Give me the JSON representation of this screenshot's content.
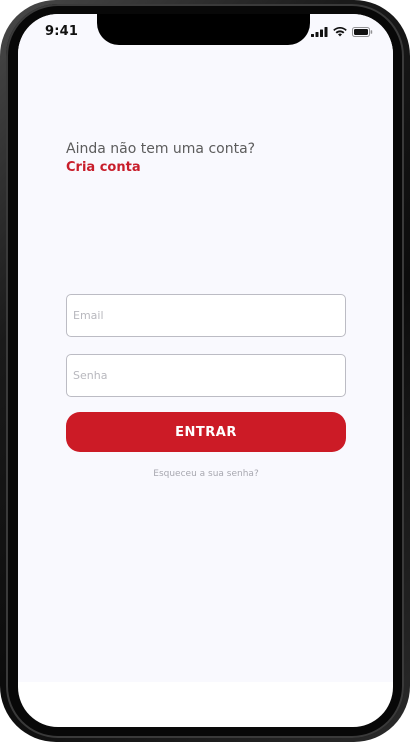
{
  "status_bar": {
    "time": "9:41",
    "icons": [
      "signal-icon",
      "wifi-icon",
      "battery-icon"
    ]
  },
  "signup": {
    "prompt": "Ainda não tem uma conta?",
    "link_label": "Cria conta"
  },
  "login_form": {
    "email_placeholder": "Email",
    "email_value": "",
    "password_placeholder": "Senha",
    "password_value": "",
    "submit_label": "ENTRAR",
    "forgot_label": "Esqueceu a sua senha?"
  },
  "colors": {
    "accent": "#cc1b26",
    "link": "#c81e2b",
    "screen_background": "#f9f9fe"
  }
}
